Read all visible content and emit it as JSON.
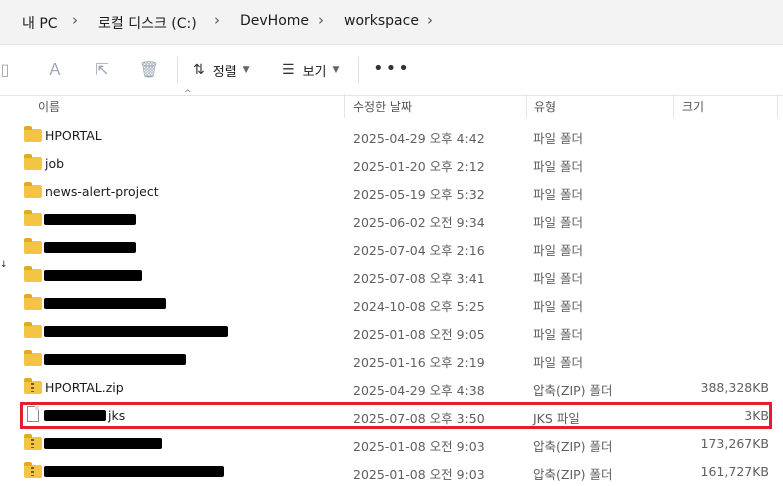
{
  "breadcrumb": {
    "items": [
      "내 PC",
      "로컬 디스크 (C:)",
      "DevHome",
      "workspace"
    ]
  },
  "toolbar": {
    "sort_label": "정렬",
    "view_label": "보기",
    "more_label": "•••",
    "icons": [
      "copy-icon",
      "rename-icon",
      "share-icon",
      "delete-icon",
      "sort-icon",
      "view-icon"
    ]
  },
  "columns": {
    "name": "이름",
    "modified": "수정한 날짜",
    "type": "유형",
    "size": "크기"
  },
  "files": [
    {
      "name": "HPORTAL",
      "date": "2025-04-29 오후 4:42",
      "type": "파일 폴더",
      "size": "",
      "kind": "folder"
    },
    {
      "name": "job",
      "date": "2025-01-20 오후 2:12",
      "type": "파일 폴더",
      "size": "",
      "kind": "folder"
    },
    {
      "name": "news-alert-project",
      "date": "2025-05-19 오후 5:32",
      "type": "파일 폴더",
      "size": "",
      "kind": "folder"
    },
    {
      "name": "",
      "date": "2025-06-02 오전 9:34",
      "type": "파일 폴더",
      "size": "",
      "kind": "folder",
      "redacted": true
    },
    {
      "name": "",
      "date": "2025-07-04 오후 2:16",
      "type": "파일 폴더",
      "size": "",
      "kind": "folder",
      "redacted": true
    },
    {
      "name": "",
      "date": "2025-07-08 오후 3:41",
      "type": "파일 폴더",
      "size": "",
      "kind": "folder",
      "redacted": true
    },
    {
      "name": "",
      "date": "2024-10-08 오후 5:25",
      "type": "파일 폴더",
      "size": "",
      "kind": "folder",
      "redacted": true
    },
    {
      "name": "",
      "date": "2025-01-08 오전 9:05",
      "type": "파일 폴더",
      "size": "",
      "kind": "folder",
      "redacted": true
    },
    {
      "name": "",
      "date": "2025-01-16 오후 2:19",
      "type": "파일 폴더",
      "size": "",
      "kind": "folder",
      "redacted": true
    },
    {
      "name": "HPORTAL.zip",
      "date": "2025-04-29 오후 4:38",
      "type": "압축(ZIP) 폴더",
      "size": "388,328KB",
      "kind": "zip"
    },
    {
      "name": "jks",
      "date": "2025-07-08 오후 3:50",
      "type": "JKS 파일",
      "size": "3KB",
      "kind": "file",
      "redacted": true,
      "highlighted": true
    },
    {
      "name": "",
      "date": "2025-01-08 오전 9:03",
      "type": "압축(ZIP) 폴더",
      "size": "173,267KB",
      "kind": "zip",
      "redacted": true
    },
    {
      "name": "",
      "date": "2025-01-08 오전 9:03",
      "type": "압축(ZIP) 폴더",
      "size": "161,727KB",
      "kind": "zip",
      "redacted": true
    }
  ],
  "colors": {
    "highlight": "#e02030",
    "folder": "#f4c542"
  }
}
